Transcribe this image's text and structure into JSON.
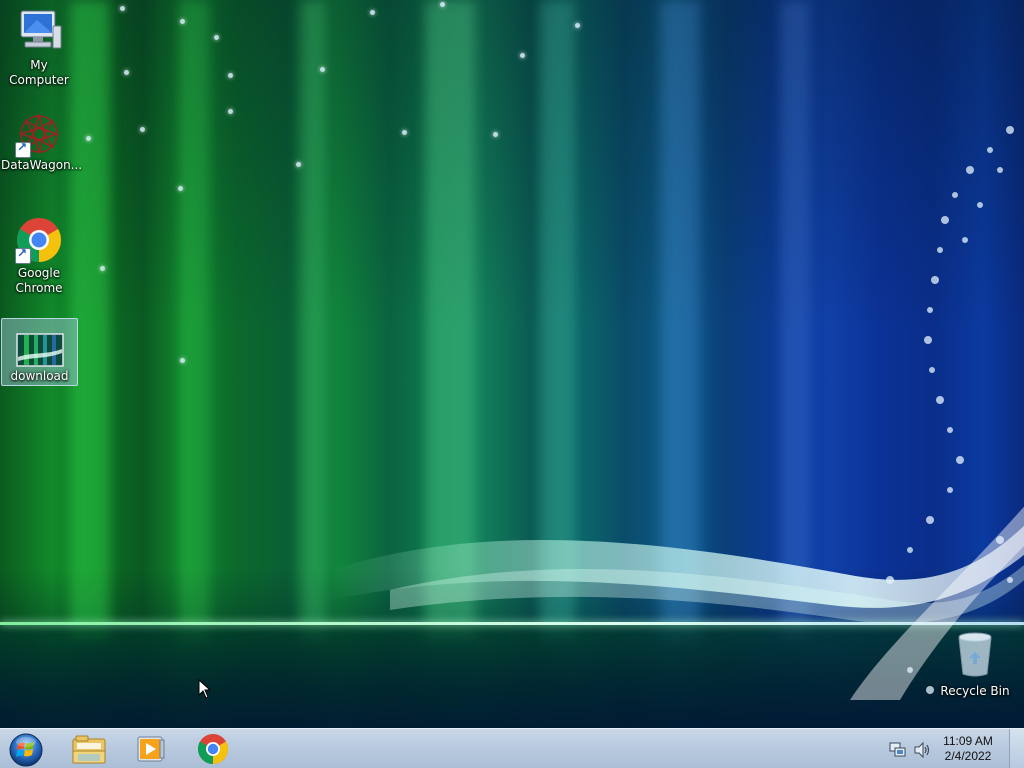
{
  "desktop": {
    "icons": [
      {
        "label": "My Computer",
        "icon": "computer-icon",
        "shortcut": false
      },
      {
        "label": "DataWagon...",
        "icon": "datawagon-icon",
        "shortcut": true
      },
      {
        "label": "Google Chrome",
        "icon": "chrome-icon",
        "shortcut": true
      },
      {
        "label": "download",
        "icon": "image-file-icon",
        "shortcut": false,
        "selected": true
      },
      {
        "label": "Recycle Bin",
        "icon": "recycle-bin-icon",
        "shortcut": false
      }
    ]
  },
  "taskbar": {
    "start": {
      "icon": "windows-start-orb-icon"
    },
    "pinned": [
      {
        "name": "Windows Explorer",
        "icon": "file-explorer-icon"
      },
      {
        "name": "Windows Media Player",
        "icon": "media-player-icon"
      },
      {
        "name": "Google Chrome",
        "icon": "chrome-icon"
      }
    ],
    "tray": {
      "icons": [
        "network-icon",
        "volume-icon"
      ],
      "time": "11:09 AM",
      "date": "2/4/2022"
    }
  },
  "colors": {
    "taskbar": "#b9cadf",
    "selection": "#aac8e6",
    "wallpaper_green": "#118a2a",
    "wallpaper_blue": "#0c3a96"
  }
}
